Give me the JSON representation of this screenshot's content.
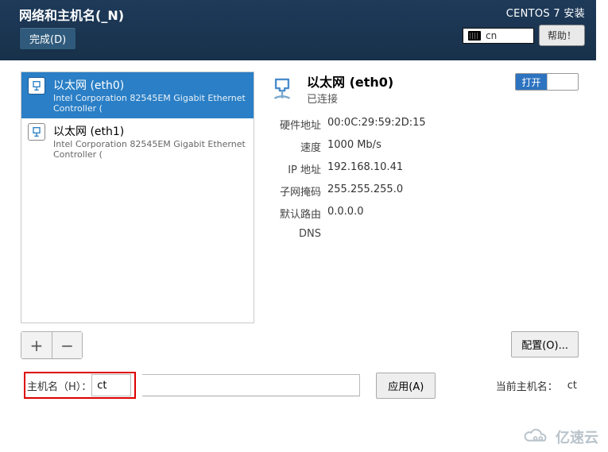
{
  "header": {
    "page_title": "网络和主机名(_N)",
    "done_button": "完成(D)",
    "brand": "CENTOS 7 安装",
    "keyboard_layout": "cn",
    "help_button": "帮助！"
  },
  "interfaces": [
    {
      "name": "以太网 (eth0)",
      "subtitle": "Intel Corporation 82545EM Gigabit Ethernet Controller (",
      "selected": true
    },
    {
      "name": "以太网 (eth1)",
      "subtitle": "Intel Corporation 82545EM Gigabit Ethernet Controller (",
      "selected": false
    }
  ],
  "detail": {
    "title": "以太网 (eth0)",
    "status": "已连接",
    "switch_on_label": "打开",
    "rows": {
      "hw_label": "硬件地址",
      "hw_value": "00:0C:29:59:2D:15",
      "speed_label": "速度",
      "speed_value": "1000 Mb/s",
      "ip_label": "IP 地址",
      "ip_value": "192.168.10.41",
      "mask_label": "子网掩码",
      "mask_value": "255.255.255.0",
      "route_label": "默认路由",
      "route_value": "0.0.0.0",
      "dns_label": "DNS",
      "dns_value": ""
    },
    "configure_button": "配置(O)..."
  },
  "buttons": {
    "add": "+",
    "remove": "−"
  },
  "footer": {
    "hostname_label": "主机名（H）：",
    "hostname_value": "ct",
    "apply_button": "应用(A)",
    "current_hostname_label": "当前主机名：",
    "current_hostname_value": "ct"
  },
  "colors": {
    "accent": "#2a7fc6",
    "header_bg": "#1e3a5a"
  },
  "watermark": "亿速云"
}
